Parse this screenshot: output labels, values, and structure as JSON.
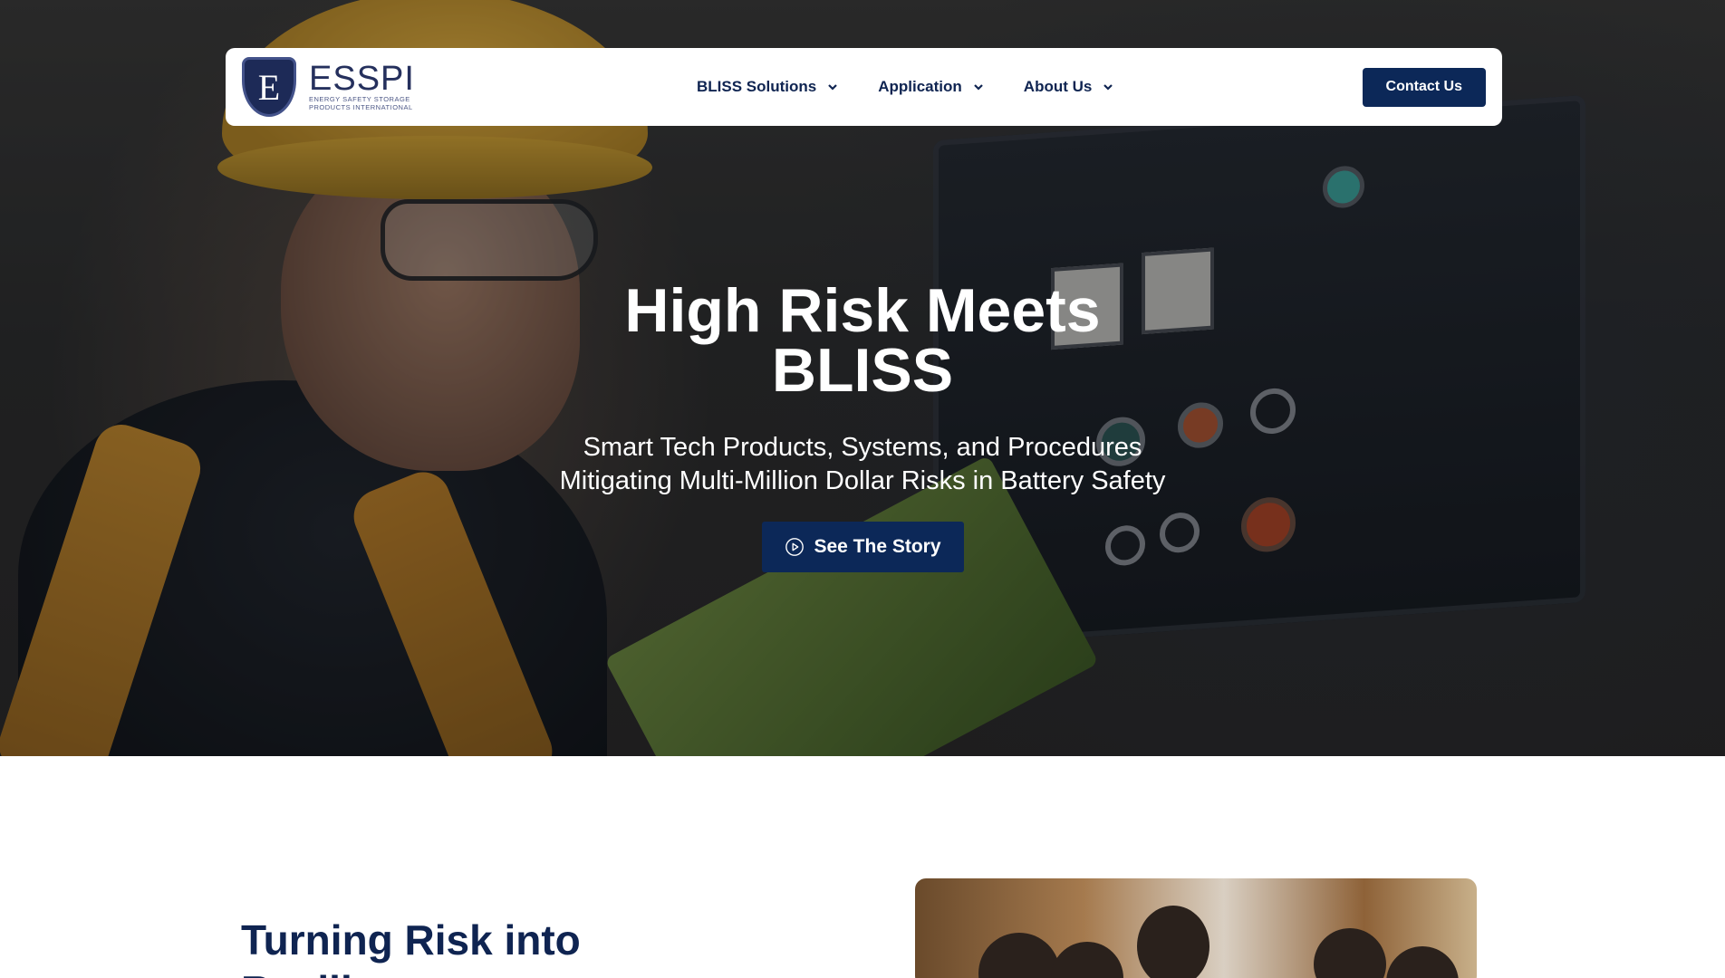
{
  "brand": {
    "logo_letter": "E",
    "name": "ESSPI",
    "tagline_line1": "ENERGY SAFETY STORAGE",
    "tagline_line2": "PRODUCTS INTERNATIONAL"
  },
  "nav": {
    "items": [
      {
        "label": "BLISS Solutions",
        "icon": "chevron-down-icon"
      },
      {
        "label": "Application",
        "icon": "chevron-down-icon"
      },
      {
        "label": "About Us",
        "icon": "chevron-down-icon"
      }
    ],
    "contact_label": "Contact Us"
  },
  "hero": {
    "title_line1": "High Risk Meets",
    "title_line2": "BLISS",
    "subtitle_line1": "Smart Tech Products, Systems, and Procedures",
    "subtitle_line2": "Mitigating Multi-Million Dollar Risks in Battery Safety",
    "cta_label": "See The Story",
    "cta_icon": "play-circle-icon"
  },
  "section": {
    "title_line1": "Turning Risk into",
    "title_line2": "Resilience"
  },
  "colors": {
    "primary": "#0c2858",
    "nav_text": "#0f2451",
    "logo": "#25305d"
  }
}
